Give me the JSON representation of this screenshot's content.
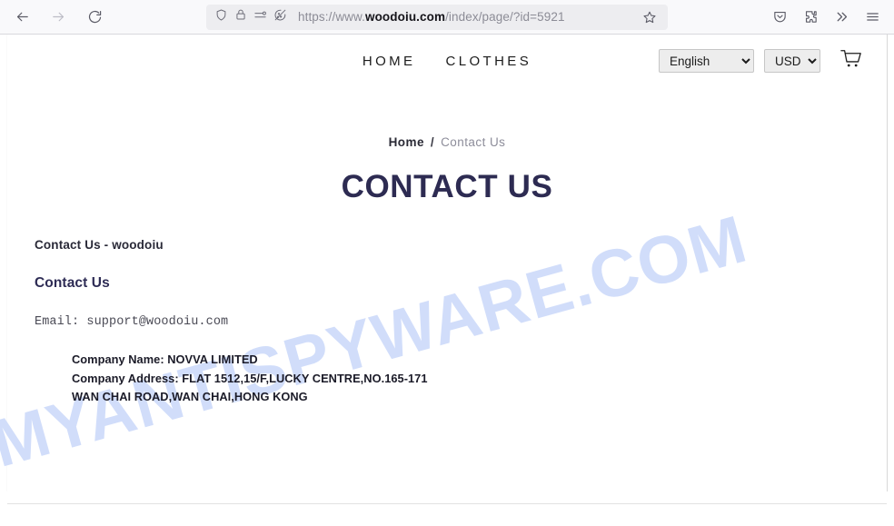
{
  "browser": {
    "back_icon": "back-arrow-icon",
    "forward_icon": "forward-arrow-icon",
    "reload_icon": "reload-icon",
    "shield_icon": "tracking-protection-shield-icon",
    "lock_icon": "padlock-icon",
    "permissions_icon": "site-permissions-icon",
    "cookie_blocked_icon": "cookie-blocked-icon",
    "bookmark_icon": "bookmark-star-icon",
    "pocket_icon": "save-to-pocket-icon",
    "extensions_icon": "extensions-puzzle-icon",
    "overflow_icon": "overflow-chevrons-icon",
    "menu_icon": "hamburger-menu-icon",
    "url": {
      "scheme": "https://www.",
      "domain": "woodoiu.com",
      "path": "/index/page/?id=5921",
      "full": "https://www.woodoiu.com/index/page/?id=5921"
    }
  },
  "site": {
    "nav": [
      {
        "label": "HOME"
      },
      {
        "label": "CLOTHES"
      }
    ],
    "language": {
      "selected": "English",
      "options": [
        "English"
      ]
    },
    "currency": {
      "selected": "USD",
      "options": [
        "USD"
      ]
    },
    "cart_icon": "shopping-cart-icon"
  },
  "breadcrumb": {
    "home": "Home",
    "separator": "/",
    "current": "Contact Us"
  },
  "page": {
    "title": "CONTACT US",
    "article_title": "Contact Us - woodoiu",
    "section_heading": "Contact Us",
    "email_line": "Email: support@woodoiu.com",
    "company_name_line": "Company Name: NOVVA LIMITED",
    "company_address_line1": "Company Address: FLAT 1512,15/F,LUCKY CENTRE,NO.165-171",
    "company_address_line2": "WAN CHAI ROAD,WAN CHAI,HONG KONG"
  },
  "watermark": {
    "text": "MYANTISPYWARE.COM",
    "color": "#cfdcfa"
  },
  "colors": {
    "title_navy": "#2d2b52",
    "chrome_bg": "#f9f9fb",
    "urlbar_bg": "#ededf0",
    "nav_text": "#1c1c1c"
  }
}
